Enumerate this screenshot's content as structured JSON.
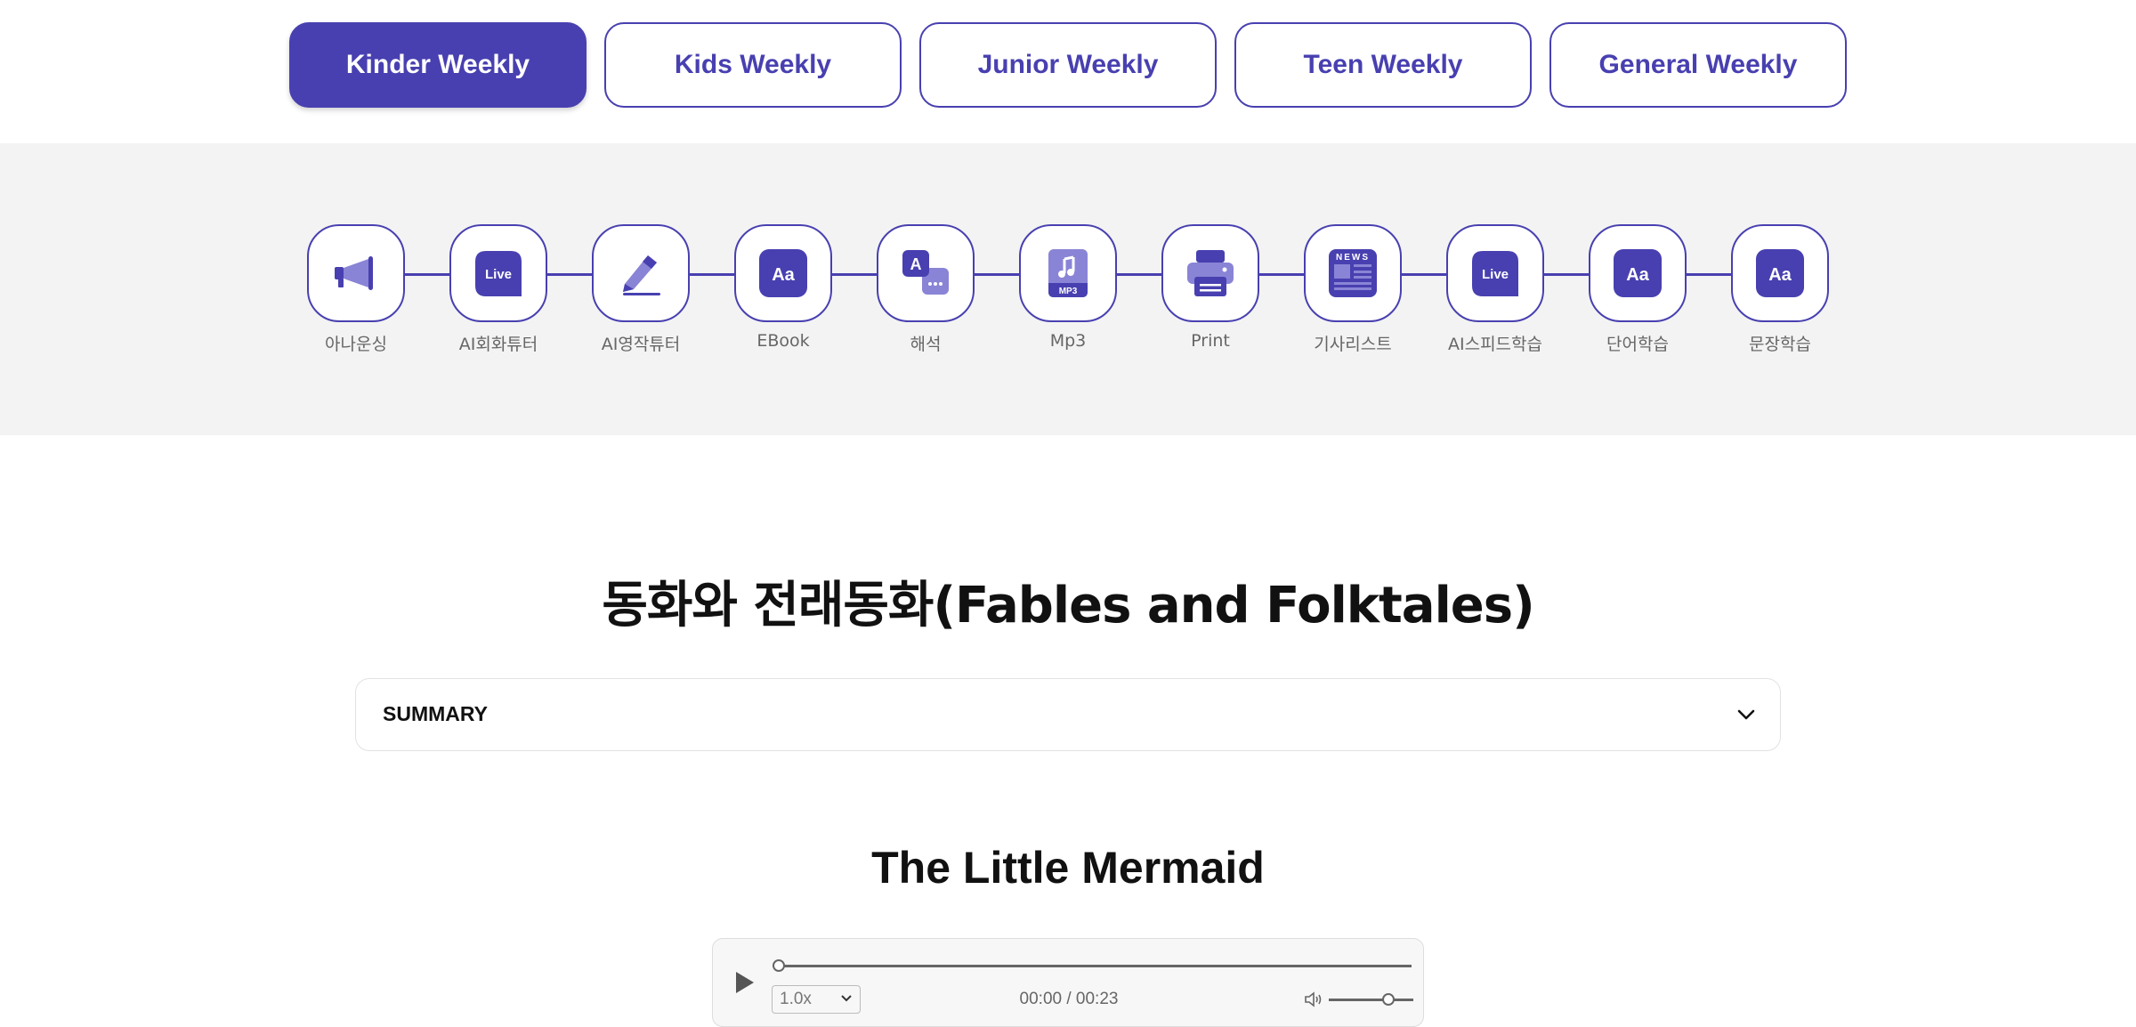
{
  "tabs": [
    {
      "label": "Kinder Weekly",
      "active": true
    },
    {
      "label": "Kids Weekly",
      "active": false
    },
    {
      "label": "Junior Weekly",
      "active": false
    },
    {
      "label": "Teen Weekly",
      "active": false
    },
    {
      "label": "General Weekly",
      "active": false
    }
  ],
  "features": [
    {
      "label": "아나운싱",
      "icon": "megaphone-icon"
    },
    {
      "label": "AI회화튜터",
      "icon": "live-chat-icon",
      "icon_text": "Live"
    },
    {
      "label": "AI영작튜터",
      "icon": "pencil-icon"
    },
    {
      "label": "EBook",
      "icon": "ebook-icon",
      "icon_text": "Aa"
    },
    {
      "label": "해석",
      "icon": "translate-icon",
      "icon_text": "A"
    },
    {
      "label": "Mp3",
      "icon": "mp3-icon",
      "icon_text": "MP3"
    },
    {
      "label": "Print",
      "icon": "printer-icon"
    },
    {
      "label": "기사리스트",
      "icon": "news-icon",
      "icon_text": "NEWS"
    },
    {
      "label": "AI스피드학습",
      "icon": "live-chat-icon",
      "icon_text": "Live"
    },
    {
      "label": "단어학습",
      "icon": "word-icon",
      "icon_text": "Aa"
    },
    {
      "label": "문장학습",
      "icon": "sentence-icon",
      "icon_text": "Aa"
    }
  ],
  "category_title": "동화와 전래동화(Fables and Folktales)",
  "summary": {
    "label": "SUMMARY",
    "icon": "chevron-down-icon"
  },
  "story_title": "The Little Mermaid",
  "player": {
    "speed": "1.0x",
    "time": "00:00 / 00:23",
    "progress": 0.0,
    "volume": 0.7,
    "play_icon": "play-icon",
    "volume_icon": "volume-icon"
  },
  "colors": {
    "accent": "#4840b0",
    "accent_light": "#8a84d6",
    "band_bg": "#f3f3f3",
    "text_dark": "#111111",
    "text_muted": "#666666"
  }
}
